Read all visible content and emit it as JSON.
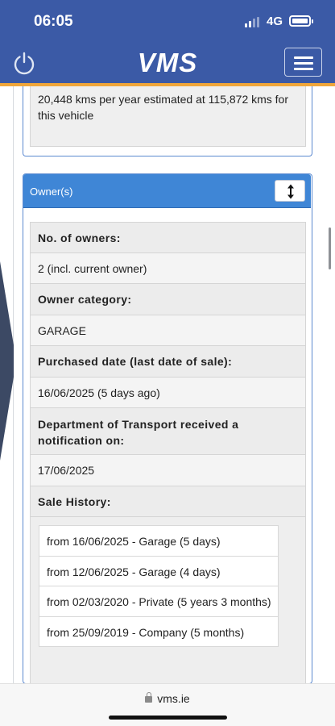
{
  "status_bar": {
    "time": "06:05",
    "network": "4G"
  },
  "header": {
    "logo_text": "VMS",
    "brand_color": "#3b5aa6",
    "accent_color": "#f0a63a"
  },
  "mileage": {
    "text": "20,448 kms per year estimated at 115,872 kms for this vehicle"
  },
  "owners_panel": {
    "title": "Owner(s)",
    "header_color": "#3f86d6",
    "rows": {
      "num_owners_label": "No. of owners:",
      "num_owners_value": "2 (incl. current owner)",
      "category_label": "Owner category:",
      "category_value": "GARAGE",
      "purchased_label": "Purchased date (last date of sale):",
      "purchased_value": "16/06/2025 (5 days ago)",
      "dot_label": "Department of Transport received a notification on:",
      "dot_value": "17/06/2025",
      "history_label": "Sale History:"
    },
    "sale_history": [
      "from 16/06/2025 - Garage (5 days)",
      "from 12/06/2025 - Garage (4 days)",
      "from 02/03/2020 - Private (5 years 3 months)",
      "from 25/09/2019 - Company (5 months)"
    ]
  },
  "browser": {
    "url": "vms.ie"
  }
}
